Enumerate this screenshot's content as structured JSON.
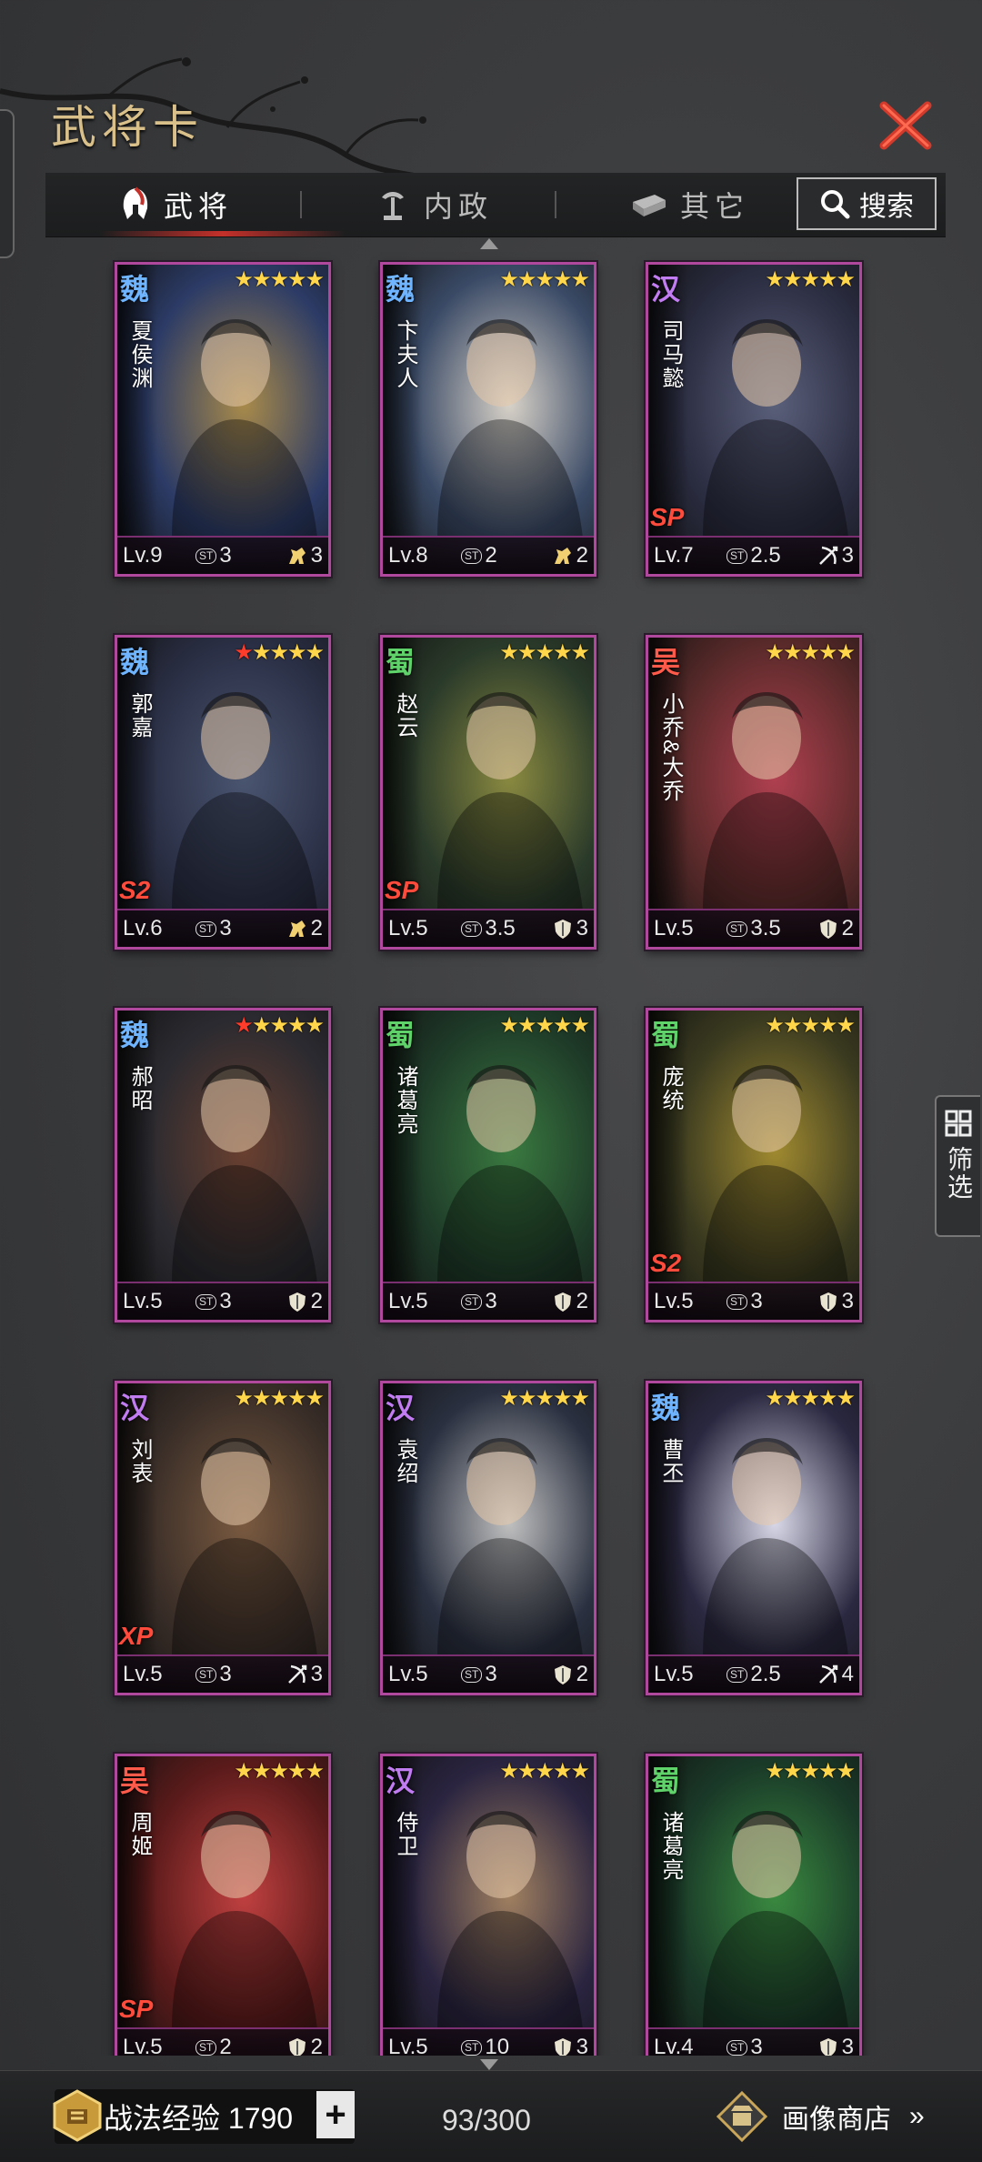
{
  "header": {
    "title": "武将卡"
  },
  "tabs": [
    {
      "label": "武将",
      "icon": "helmet-icon",
      "active": true
    },
    {
      "label": "内政",
      "icon": "govern-icon",
      "active": false
    },
    {
      "label": "其它",
      "icon": "misc-icon",
      "active": false
    }
  ],
  "search": {
    "label": "搜索"
  },
  "side_filter": {
    "label": "筛选"
  },
  "colors": {
    "wei": "#6fb4ff",
    "shu": "#5fd36a",
    "wu": "#ff5a4a",
    "han": "#c07cf0",
    "card_border": "#b0489e"
  },
  "cards": [
    {
      "kingdom": "魏",
      "name": "夏侯渊",
      "level": "Lv.9",
      "cost_label": "ST",
      "cost": "3",
      "unit_icon": "cavalry-icon",
      "unit_count": "3",
      "stars": 5,
      "red_stars": 0,
      "badge": ""
    },
    {
      "kingdom": "魏",
      "name": "卞夫人",
      "level": "Lv.8",
      "cost_label": "ST",
      "cost": "2",
      "unit_icon": "cavalry-icon",
      "unit_count": "2",
      "stars": 5,
      "red_stars": 0,
      "badge": ""
    },
    {
      "kingdom": "汉",
      "name": "司马懿",
      "level": "Lv.7",
      "cost_label": "ST",
      "cost": "2.5",
      "unit_icon": "archer-icon",
      "unit_count": "3",
      "stars": 5,
      "red_stars": 0,
      "badge": "SP"
    },
    {
      "kingdom": "魏",
      "name": "郭嘉",
      "level": "Lv.6",
      "cost_label": "ST",
      "cost": "3",
      "unit_icon": "cavalry-icon",
      "unit_count": "2",
      "stars": 5,
      "red_stars": 1,
      "badge": "S2"
    },
    {
      "kingdom": "蜀",
      "name": "赵云",
      "level": "Lv.5",
      "cost_label": "ST",
      "cost": "3.5",
      "unit_icon": "shield-icon",
      "unit_count": "3",
      "stars": 5,
      "red_stars": 0,
      "badge": "SP"
    },
    {
      "kingdom": "吴",
      "name": "小乔&大乔",
      "level": "Lv.5",
      "cost_label": "ST",
      "cost": "3.5",
      "unit_icon": "shield-icon",
      "unit_count": "2",
      "stars": 5,
      "red_stars": 0,
      "badge": ""
    },
    {
      "kingdom": "魏",
      "name": "郝昭",
      "level": "Lv.5",
      "cost_label": "ST",
      "cost": "3",
      "unit_icon": "shield-icon",
      "unit_count": "2",
      "stars": 5,
      "red_stars": 1,
      "badge": ""
    },
    {
      "kingdom": "蜀",
      "name": "诸葛亮",
      "level": "Lv.5",
      "cost_label": "ST",
      "cost": "3",
      "unit_icon": "shield-icon",
      "unit_count": "2",
      "stars": 5,
      "red_stars": 0,
      "badge": ""
    },
    {
      "kingdom": "蜀",
      "name": "庞统",
      "level": "Lv.5",
      "cost_label": "ST",
      "cost": "3",
      "unit_icon": "shield-icon",
      "unit_count": "3",
      "stars": 5,
      "red_stars": 0,
      "badge": "S2"
    },
    {
      "kingdom": "汉",
      "name": "刘表",
      "level": "Lv.5",
      "cost_label": "ST",
      "cost": "3",
      "unit_icon": "archer-icon",
      "unit_count": "3",
      "stars": 5,
      "red_stars": 0,
      "badge": "XP"
    },
    {
      "kingdom": "汉",
      "name": "袁绍",
      "level": "Lv.5",
      "cost_label": "ST",
      "cost": "3",
      "unit_icon": "shield-icon",
      "unit_count": "2",
      "stars": 5,
      "red_stars": 0,
      "badge": ""
    },
    {
      "kingdom": "魏",
      "name": "曹丕",
      "level": "Lv.5",
      "cost_label": "ST",
      "cost": "2.5",
      "unit_icon": "archer-icon",
      "unit_count": "4",
      "stars": 5,
      "red_stars": 0,
      "badge": ""
    },
    {
      "kingdom": "吴",
      "name": "周姬",
      "level": "Lv.5",
      "cost_label": "ST",
      "cost": "2",
      "unit_icon": "shield-icon",
      "unit_count": "2",
      "stars": 5,
      "red_stars": 0,
      "badge": "SP"
    },
    {
      "kingdom": "汉",
      "name": "侍卫",
      "level": "Lv.5",
      "cost_label": "ST",
      "cost": "10",
      "unit_icon": "shield-icon",
      "unit_count": "3",
      "stars": 5,
      "red_stars": 0,
      "badge": ""
    },
    {
      "kingdom": "蜀",
      "name": "诸葛亮",
      "level": "Lv.4",
      "cost_label": "ST",
      "cost": "3",
      "unit_icon": "shield-icon",
      "unit_count": "3",
      "stars": 5,
      "red_stars": 0,
      "badge": ""
    }
  ],
  "footer": {
    "exp_label": "战法经验 1790",
    "plus_label": "+",
    "count": "93/300",
    "shop_label": "画像商店",
    "shop_arrow": "»"
  }
}
